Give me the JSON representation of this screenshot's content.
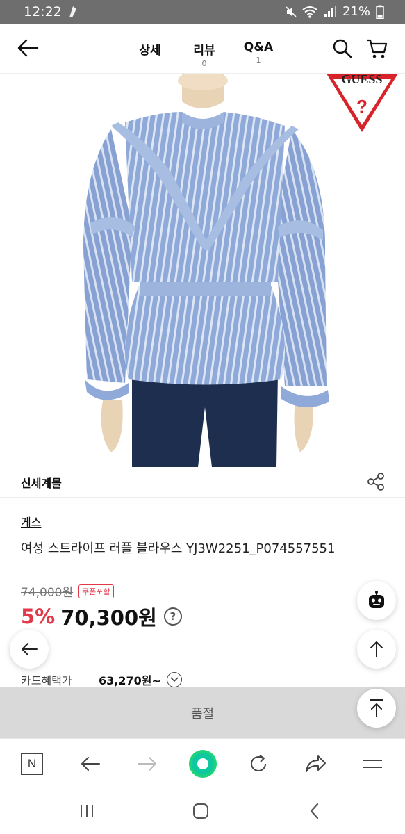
{
  "status_bar": {
    "time": "12:22",
    "battery": "21%"
  },
  "header": {
    "tabs": [
      {
        "label": "상세",
        "count": ""
      },
      {
        "label": "리뷰",
        "count": "0"
      },
      {
        "label": "Q&A",
        "count": "1"
      }
    ]
  },
  "product": {
    "brand_logo_text": "GUESS",
    "shop_name": "신세계몰",
    "brand": "게스",
    "title": "여성 스트라이프 러플 블라우스 YJ3W2251_P074557551",
    "original_price": "74,000원",
    "coupon_badge": "쿠폰포함",
    "discount": "5%",
    "final_price": "70,300원",
    "help_label": "?",
    "card_label": "카드혜택가",
    "card_price": "63,270원~"
  },
  "soldout": {
    "label": "품절"
  },
  "browser_bar": {
    "home_label": "N"
  },
  "colors": {
    "discount_red": "#e2394a",
    "blouse_blue": "#8fa9d8",
    "browser_accent": "#1ed37a"
  }
}
